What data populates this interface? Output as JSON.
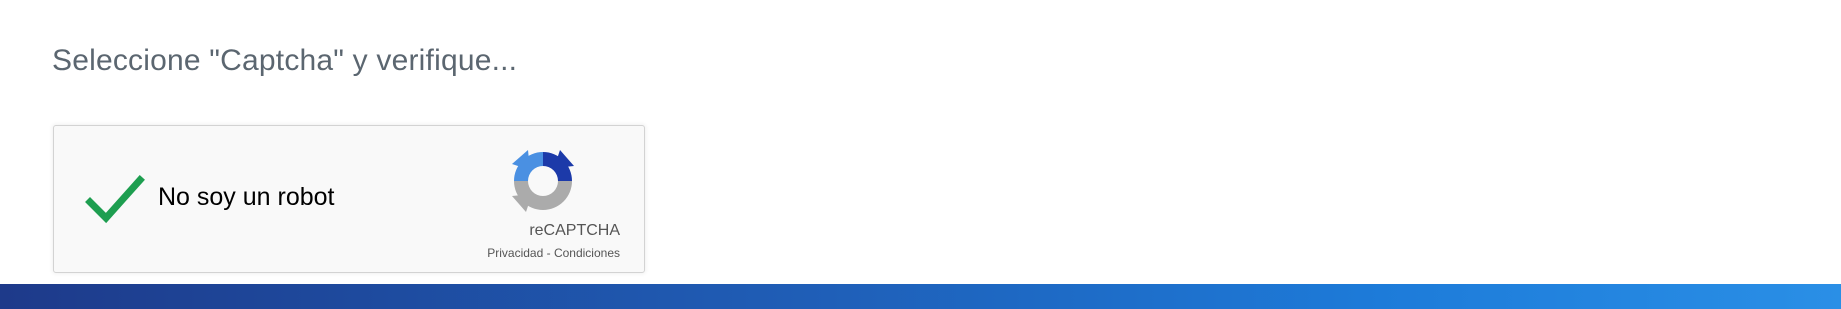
{
  "instruction": {
    "text": "Seleccione \"Captcha\" y verifique..."
  },
  "captcha": {
    "checkbox_label": "No soy un robot",
    "checked": true,
    "brand_name": "reCAPTCHA",
    "privacy_link": "Privacidad",
    "separator": " - ",
    "terms_link": "Condiciones",
    "icons": {
      "checkmark": "check-icon",
      "logo": "recaptcha-logo-icon"
    }
  },
  "colors": {
    "checkmark": "#1e9e50",
    "footer_start": "#1e3a8a",
    "footer_end": "#2a8fe6",
    "instruction_text": "#5b6670"
  }
}
